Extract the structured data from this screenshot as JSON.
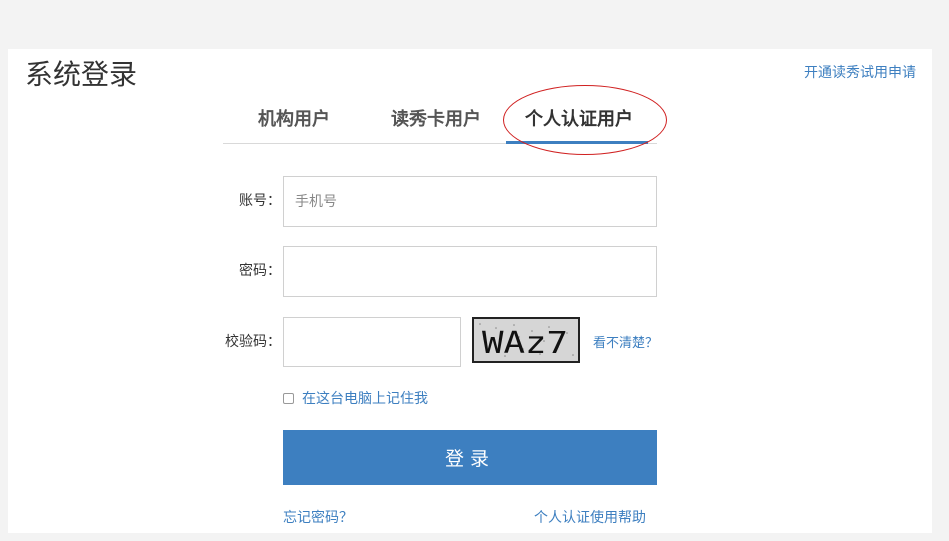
{
  "header": {
    "title": "系统登录",
    "apply_link": "开通读秀试用申请"
  },
  "tabs": [
    {
      "label": "机构用户",
      "active": false
    },
    {
      "label": "读秀卡用户",
      "active": false
    },
    {
      "label": "个人认证用户",
      "active": true
    }
  ],
  "form": {
    "account_label": "账号：",
    "account_placeholder": "手机号",
    "account_value": "",
    "password_label": "密码：",
    "password_value": "",
    "captcha_label": "校验码：",
    "captcha_value": "",
    "captcha_text": "WAz7",
    "captcha_refresh": "看不清楚？",
    "remember_label": "在这台电脑上记住我",
    "remember_checked": false,
    "submit_label": "登录"
  },
  "footer_links": {
    "forgot_password": "忘记密码？",
    "help": "个人认证使用帮助"
  },
  "colors": {
    "accent": "#3d7fc0",
    "highlight_circle": "#d02020",
    "background": "#f3f3f3"
  }
}
